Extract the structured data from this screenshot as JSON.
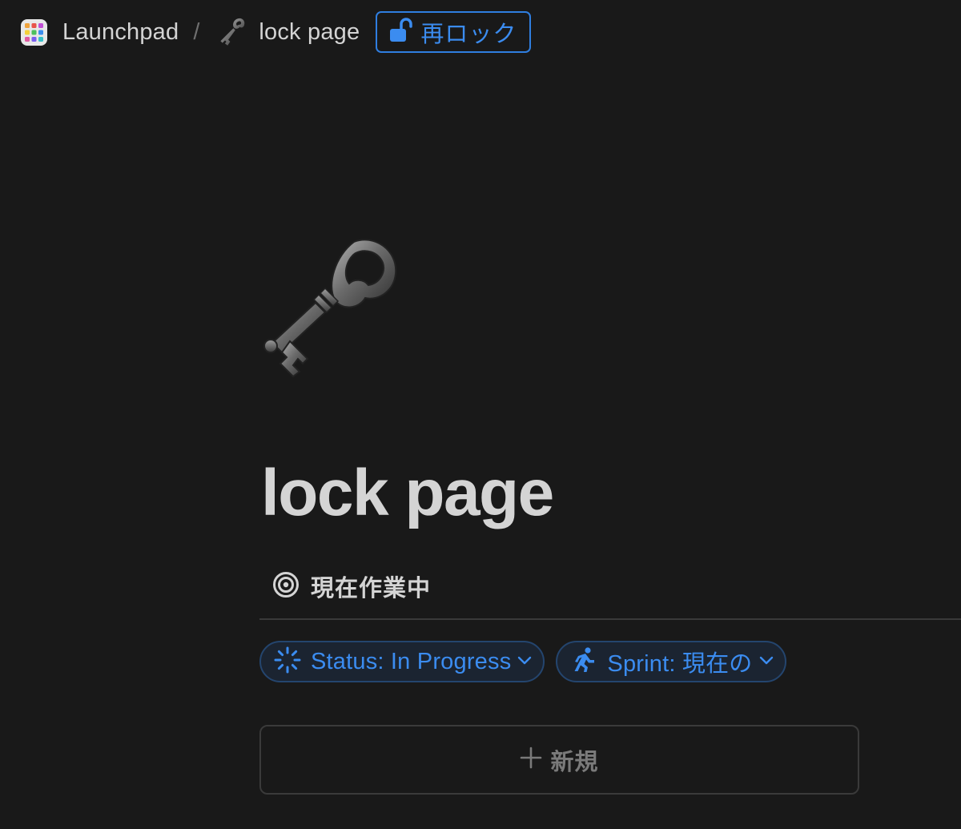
{
  "breadcrumb": {
    "workspace": {
      "label": "Launchpad",
      "icon": "launchpad-grid-icon"
    },
    "separator": "/",
    "page": {
      "label": "lock page",
      "icon": "old-key-icon"
    }
  },
  "relock": {
    "label": "再ロック",
    "icon": "unlocked-padlock-icon"
  },
  "page": {
    "icon": "old-key-icon",
    "title": "lock page"
  },
  "view_tab": {
    "label": "現在作業中",
    "icon": "target-icon"
  },
  "filters": [
    {
      "label": "Status: In Progress",
      "icon": "in-progress-spinner-icon"
    },
    {
      "label": "Sprint: 現在の",
      "icon": "runner-icon"
    }
  ],
  "new_button": {
    "label": "新規",
    "icon": "plus-icon"
  },
  "colors": {
    "background": "#191919",
    "text": "#d4d4d4",
    "accent": "#3b8cf0",
    "muted": "#7a7a7a",
    "border": "#3a3a3a"
  }
}
